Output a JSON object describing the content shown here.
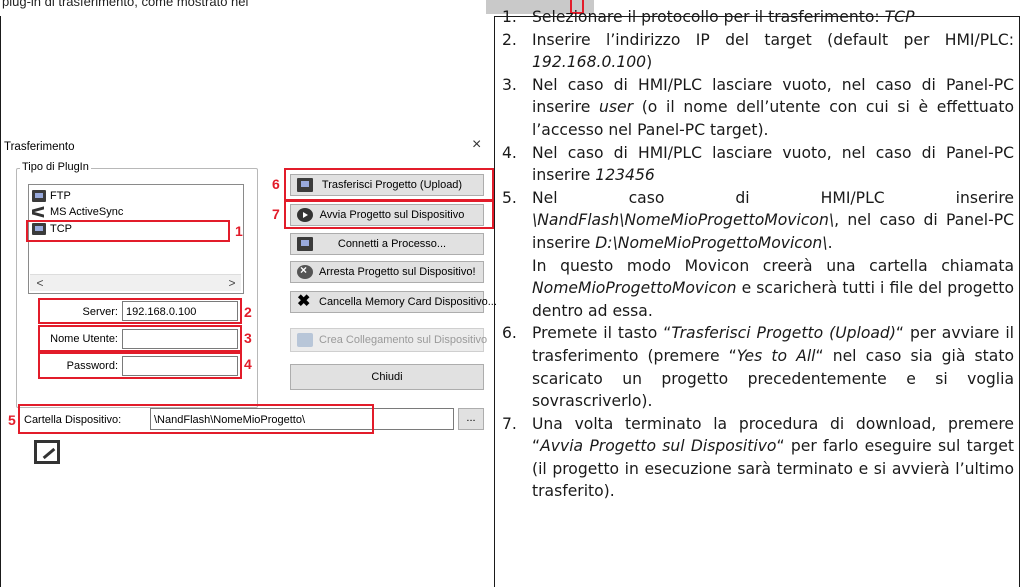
{
  "top_strip": {
    "partial_text": "plug-in di trasferimento, come mostrato nel"
  },
  "dialog": {
    "title": "Trasferimento",
    "close_glyph": "×",
    "group_label": "Tipo di PlugIn",
    "plugins": [
      "FTP",
      "MS ActiveSync",
      "TCP"
    ],
    "selected_plugin": "TCP",
    "scroll_left": "<",
    "scroll_right": ">",
    "server_label": "Server:",
    "server_value": "192.168.0.100",
    "user_label": "Nome Utente:",
    "user_value": "",
    "password_label": "Password:",
    "password_value": "",
    "buttons": {
      "upload": "Trasferisci Progetto (Upload)",
      "run": "Avvia Progetto sul Dispositivo",
      "connect": "Connetti a Processo...",
      "stop": "Arresta Progetto sul Dispositivo!",
      "delete_card": "Cancella Memory Card Dispositivo...",
      "link": "Crea Collegamento sul Dispositivo",
      "close": "Chiudi"
    },
    "folder_label": "Cartella Dispositivo:",
    "folder_value": "\\NandFlash\\NomeMioProgetto\\",
    "browse_label": "...",
    "callouts": [
      "1",
      "2",
      "3",
      "4",
      "5",
      "6",
      "7"
    ]
  },
  "instructions": {
    "steps": [
      {
        "num": "1.",
        "text_a": "Selezionare il protocollo per il trasferimento: ",
        "em_a": "TCP"
      },
      {
        "num": "2.",
        "text_a": "Inserire l’indirizzo IP del target (default per HMI/PLC: ",
        "em_a": "192.168.0.100",
        "text_b": ")"
      },
      {
        "num": "3.",
        "text_a": "Nel caso di HMI/PLC lasciare vuoto, nel caso di Panel-PC inserire ",
        "em_a": "user",
        "text_b": " (o il nome dell’utente con cui si è effettuato l’accesso nel Panel-PC target)."
      },
      {
        "num": "4.",
        "text_a": "Nel caso di HMI/PLC lasciare vuoto, nel caso di Panel-PC inserire ",
        "em_a": "123456"
      },
      {
        "num": "5.",
        "text_a": "Nel caso di HMI/PLC inserire ",
        "em_a": "\\NandFlash\\NomeMioProgettoMovicon\\",
        "text_b": ", nel caso di Panel-PC inserire ",
        "em_b": "D:\\NomeMioProgettoMovicon\\",
        "text_c": ".",
        "extra_a": "In questo modo Movicon creerà una cartella chiamata ",
        "extra_em": "NomeMioProgettoMovicon",
        "extra_b": " e scaricherà tutti i file del progetto dentro ad essa."
      },
      {
        "num": "6.",
        "text_a": "Premete il tasto “",
        "em_a": "Trasferisci Progetto (Upload)",
        "text_b": "“ per avviare il trasferimento (premere “",
        "em_b": "Yes to All",
        "text_c": "“ nel caso sia già stato scaricato un progetto precedentemente e si voglia sovrascriverlo)."
      },
      {
        "num": "7.",
        "text_a": "Una volta terminato la procedura di download, premere “",
        "em_a": "Avvia Progetto sul Dispositivo",
        "text_b": "“ per farlo eseguire sul target (il progetto in esecuzione sarà terminato e si avvierà l’ultimo trasferito)."
      }
    ]
  },
  "colors": {
    "callout_red": "#e21c2a",
    "button_face": "#e1e1e1",
    "table_line": "#1a1a1a"
  }
}
